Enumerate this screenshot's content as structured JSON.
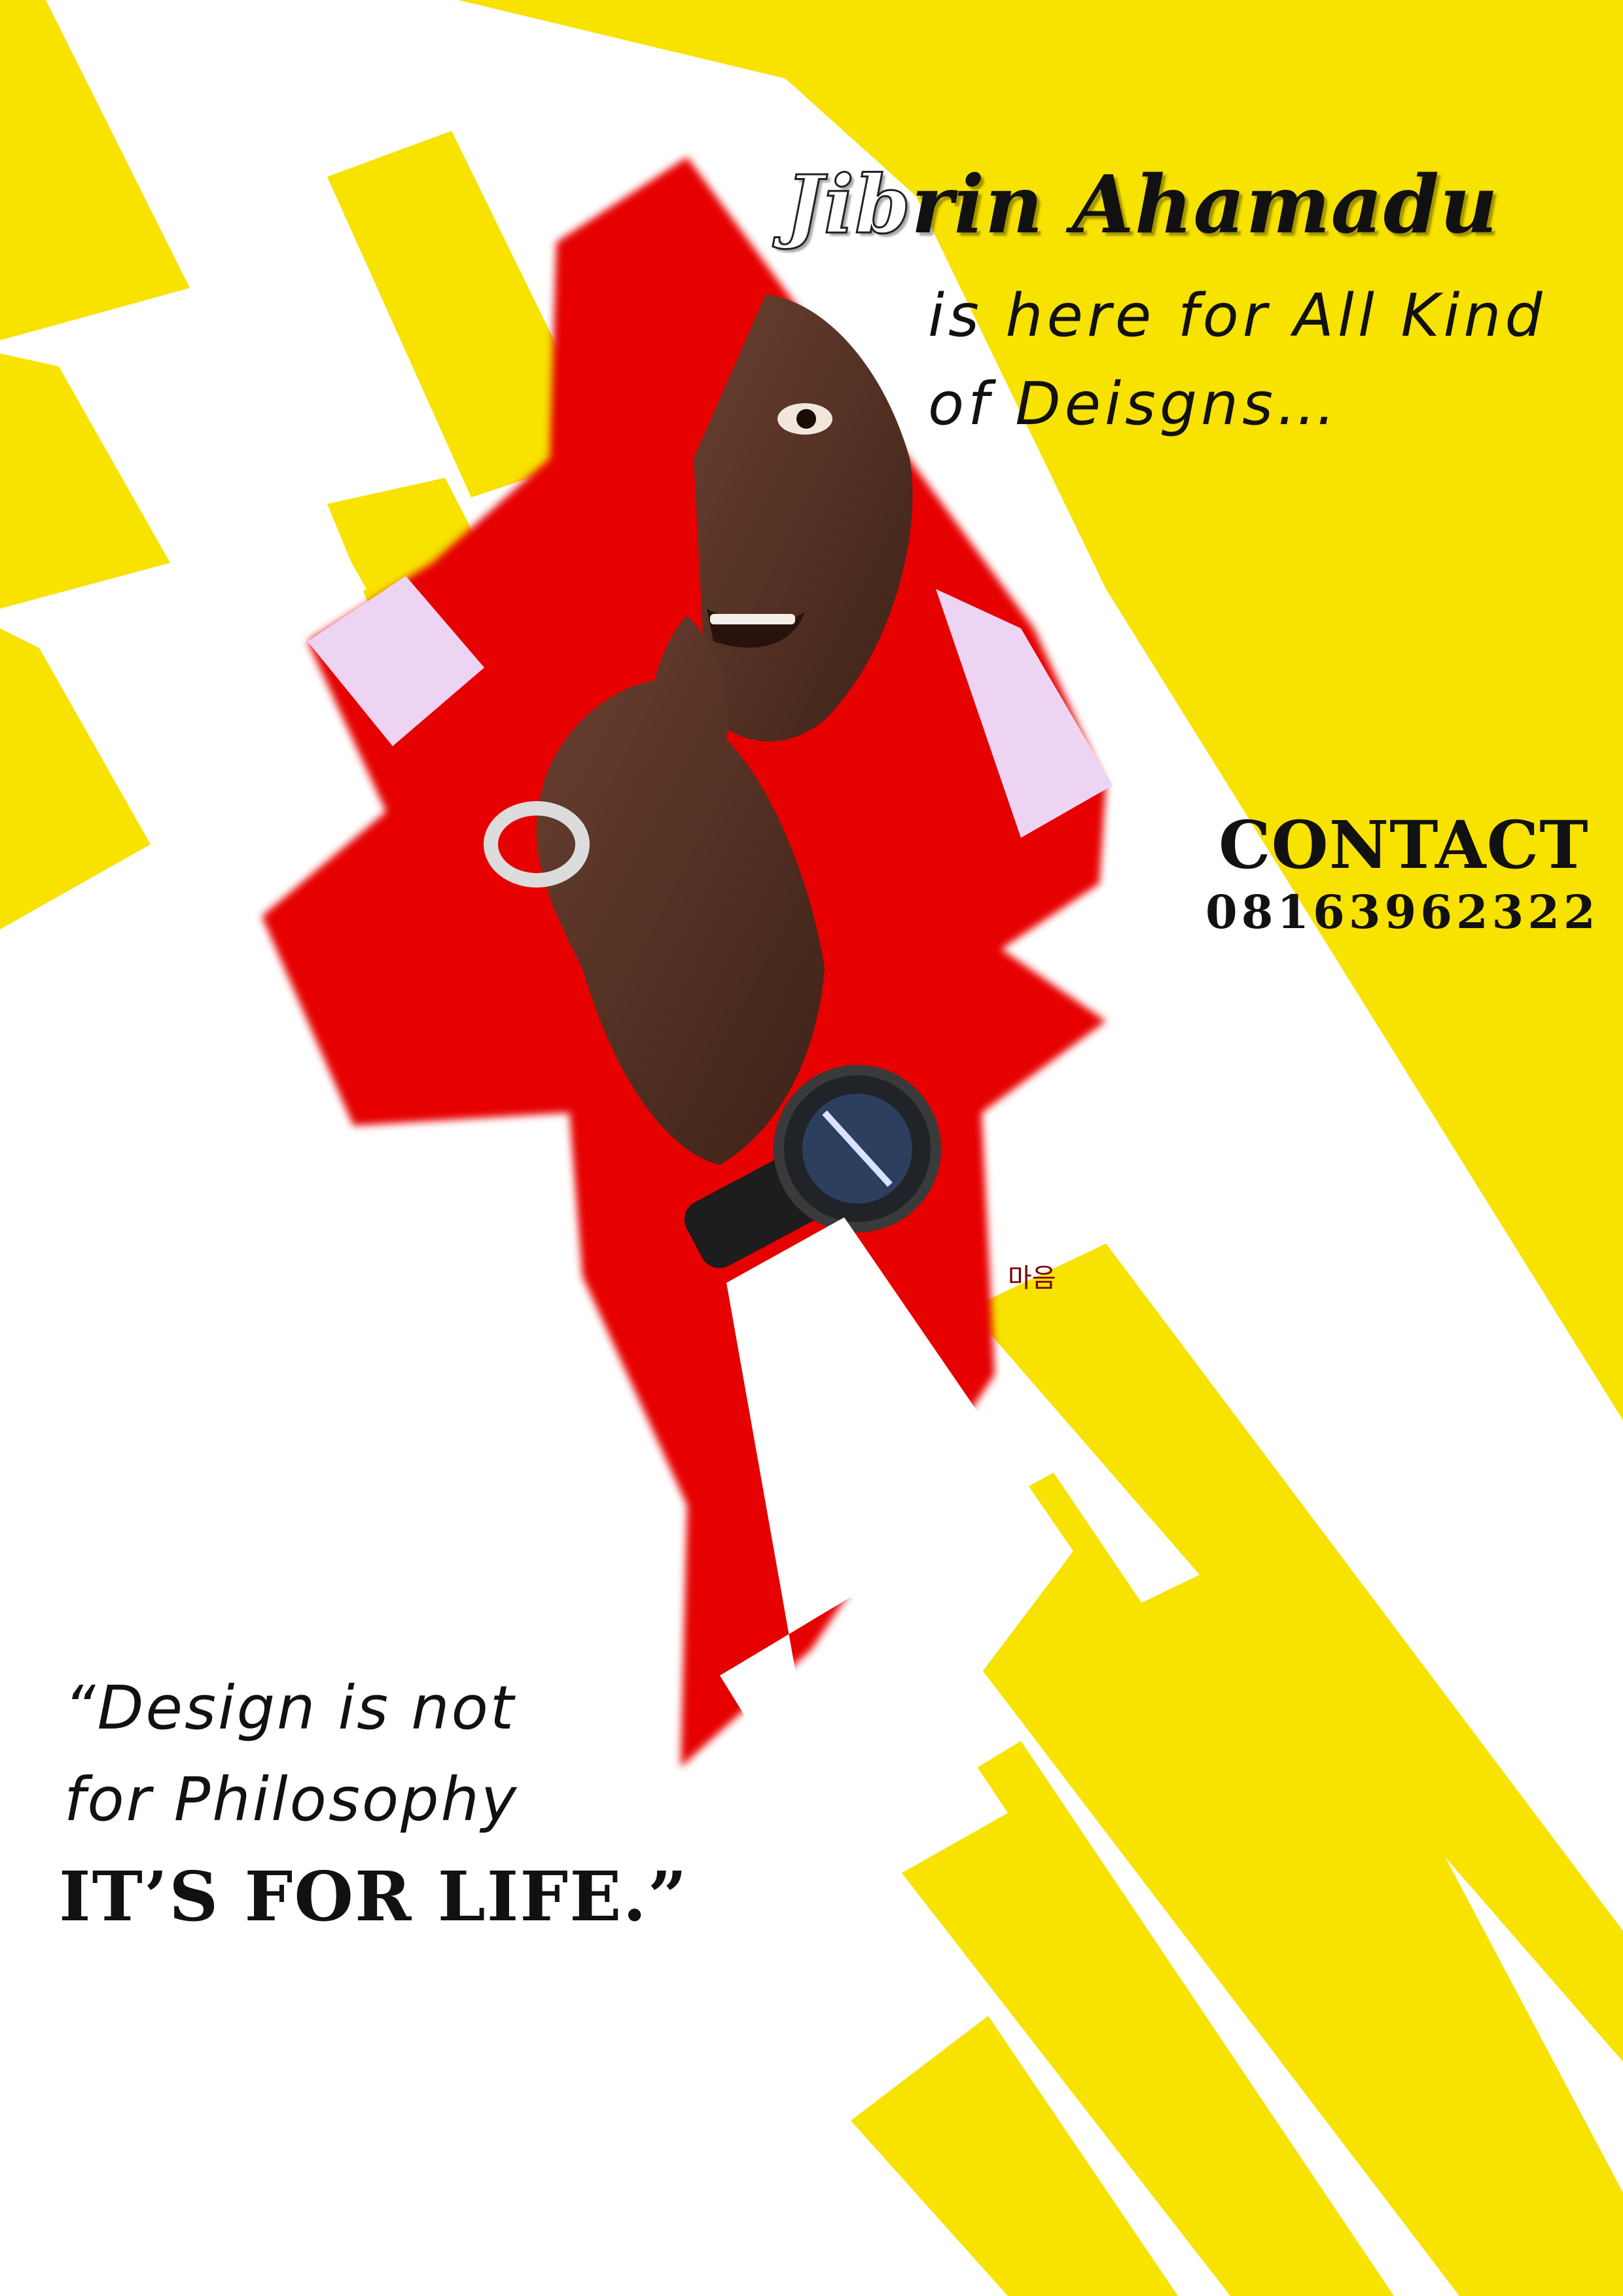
{
  "poster": {
    "name_lead": "Jib",
    "name_rest": "rin Ahamadu",
    "tagline_line1": "is here for All Kind",
    "tagline_line2": "of Deisgns…",
    "contact_label": "CONTACT",
    "contact_phone": "08163962322",
    "quote_line1": "“Design is not",
    "quote_line2": "for Philosophy",
    "quote_line3": "IT’S FOR LIFE.”",
    "photo_shirt_print": "마음"
  },
  "colors": {
    "yellow": "#F7E200",
    "white": "#FFFFFF",
    "red": "#E60000",
    "lavender": "#EDD4F2",
    "skin": "#5A3524",
    "text": "#111111"
  }
}
